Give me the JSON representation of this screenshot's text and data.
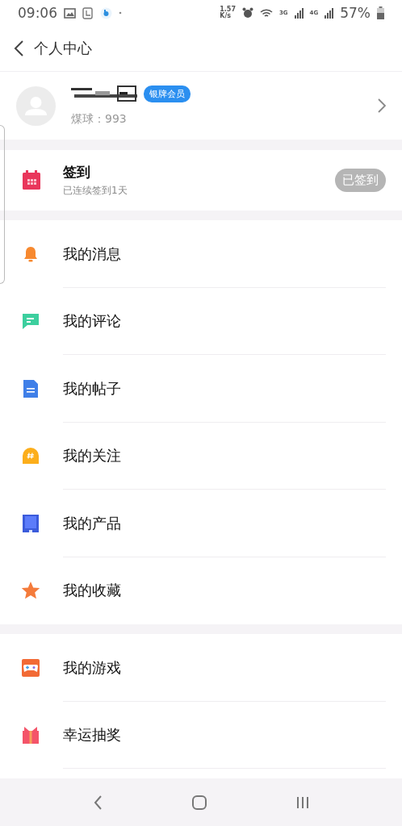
{
  "status_bar": {
    "time": "09:06",
    "speed": [
      "1.57",
      "K/s"
    ],
    "net_labels": [
      "3G",
      "4G"
    ],
    "battery": "57%"
  },
  "header": {
    "title": "个人中心"
  },
  "profile": {
    "badge": "银牌会员",
    "points": "煤球：993"
  },
  "checkin": {
    "title": "签到",
    "subtitle": "已连续签到1天",
    "button": "已签到",
    "done": true
  },
  "groups": [
    [
      {
        "kind": "bell",
        "label": "我的消息"
      },
      {
        "kind": "comment",
        "label": "我的评论"
      },
      {
        "kind": "document",
        "label": "我的帖子"
      },
      {
        "kind": "hashtag",
        "label": "我的关注"
      },
      {
        "kind": "product",
        "label": "我的产品"
      },
      {
        "kind": "star",
        "label": "我的收藏"
      }
    ],
    [
      {
        "kind": "gamepad",
        "label": "我的游戏"
      },
      {
        "kind": "gift",
        "label": "幸运抽奖"
      }
    ]
  ]
}
